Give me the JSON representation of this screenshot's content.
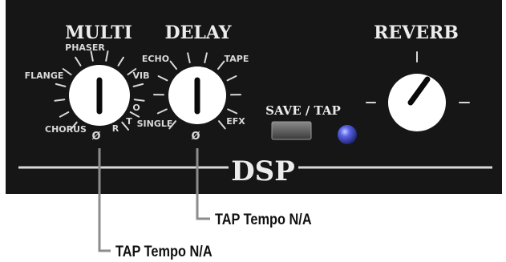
{
  "panel": {
    "section_label": "DSP",
    "colors": {
      "panel": "#161616",
      "text": "#ececec",
      "knob": "#ffffff",
      "led": "#4b56d8",
      "callout_line": "#8c8c8c"
    }
  },
  "multi_knob": {
    "title": "MULTI",
    "positions": [
      "CHORUS",
      "FLANGE",
      "PHASER",
      "VIB",
      "O",
      "T",
      "R",
      "Ø"
    ],
    "icon": "pointer-knob-icon"
  },
  "delay_knob": {
    "title": "DELAY",
    "positions": [
      "SINGLE",
      "ECHO",
      "TAPE",
      "EFX",
      "Ø"
    ],
    "icon": "pointer-knob-icon"
  },
  "reverb_knob": {
    "title": "REVERB",
    "icon": "pointer-knob-icon"
  },
  "save_tap": {
    "label": "SAVE / TAP",
    "button_icon": "push-button-icon",
    "led_icon": "led-indicator-icon"
  },
  "callouts": [
    {
      "text": "TAP Tempo N/A"
    },
    {
      "text": "TAP Tempo N/A"
    }
  ]
}
